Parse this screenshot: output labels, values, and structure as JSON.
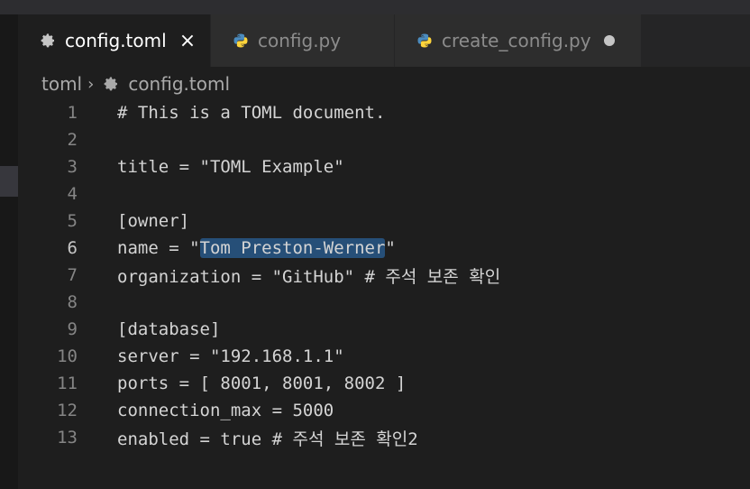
{
  "colors": {
    "editor_bg": "#1e1e1e",
    "tab_active_bg": "#1e1e1e",
    "tab_inactive_bg": "#2d2d2d",
    "selection": "#264f78",
    "python_icon": "#4b8bbe",
    "text": "#d4d4d4",
    "line_number": "#858585"
  },
  "tabs": [
    {
      "label": "config.toml",
      "icon": "gear-icon",
      "active": true,
      "close": "×"
    },
    {
      "label": "config.py",
      "icon": "python-icon",
      "active": false
    },
    {
      "label": "create_config.py",
      "icon": "python-icon",
      "active": false,
      "dirty": true
    }
  ],
  "breadcrumb": {
    "folder": "toml",
    "separator": "›",
    "file": "config.toml",
    "file_icon": "gear-icon"
  },
  "editor": {
    "current_line": 6,
    "lines": [
      {
        "n": "1",
        "text": "# This is a TOML document."
      },
      {
        "n": "2",
        "text": ""
      },
      {
        "n": "3",
        "text": "title = \"TOML Example\""
      },
      {
        "n": "4",
        "text": ""
      },
      {
        "n": "5",
        "text": "[owner]"
      },
      {
        "n": "6",
        "pre": "name = \"",
        "selected": "Tom Preston-Werner",
        "post": "\""
      },
      {
        "n": "7",
        "text": "organization = \"GitHub\" # 주석 보존 확인"
      },
      {
        "n": "8",
        "text": ""
      },
      {
        "n": "9",
        "text": "[database]"
      },
      {
        "n": "10",
        "text": "server = \"192.168.1.1\""
      },
      {
        "n": "11",
        "text": "ports = [ 8001, 8001, 8002 ]"
      },
      {
        "n": "12",
        "text": "connection_max = 5000"
      },
      {
        "n": "13",
        "text": "enabled = true # 주석 보존 확인2"
      }
    ]
  }
}
